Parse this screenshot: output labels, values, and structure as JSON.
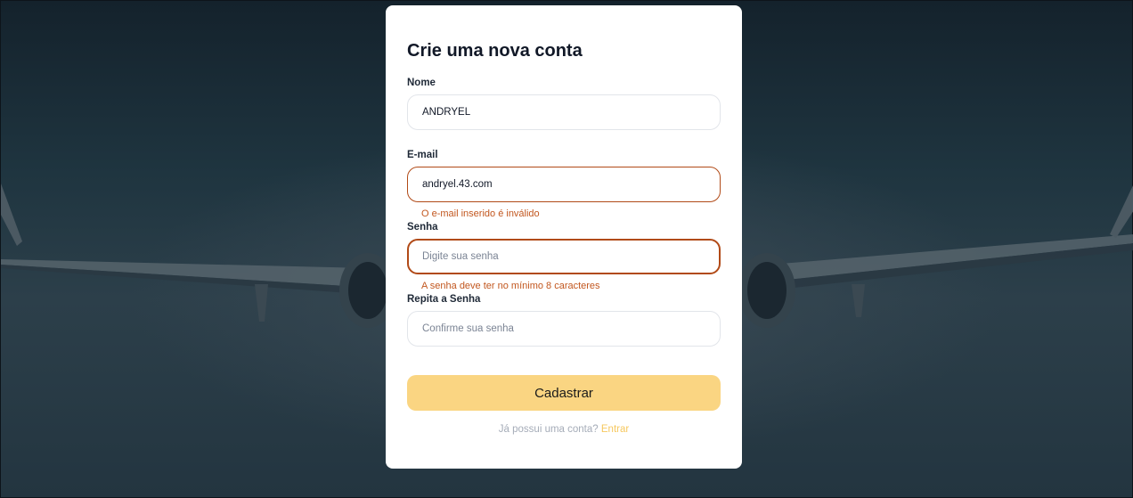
{
  "form": {
    "title": "Crie uma nova conta",
    "name": {
      "label": "Nome",
      "value": "ANDRYEL",
      "placeholder": ""
    },
    "email": {
      "label": "E-mail",
      "value": "andryel.43.com",
      "placeholder": "",
      "error": "O e-mail inserido é inválido"
    },
    "password": {
      "label": "Senha",
      "value": "",
      "placeholder": "Digite sua senha",
      "error": "A senha deve ter no mínimo 8 caracteres"
    },
    "confirm": {
      "label": "Repita a Senha",
      "value": "",
      "placeholder": "Confirme sua senha"
    },
    "submit_label": "Cadastrar",
    "footer_text": "Já possui uma conta?",
    "footer_link": "Entrar"
  },
  "colors": {
    "accent": "#fad582",
    "error": "#b14a17",
    "link": "#f6c85f"
  }
}
